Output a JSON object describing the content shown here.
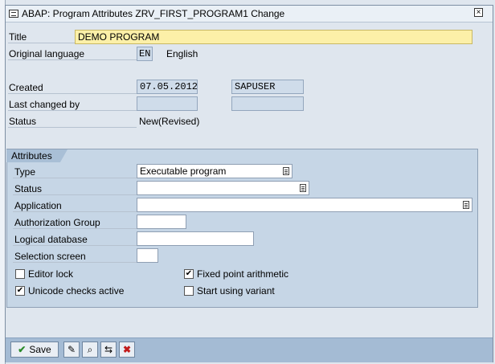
{
  "window": {
    "title": "ABAP: Program Attributes ZRV_FIRST_PROGRAM1 Change"
  },
  "header": {
    "title_label": "Title",
    "title_value": "DEMO PROGRAM",
    "orig_lang_label": "Original language",
    "orig_lang_code": "EN",
    "orig_lang_name": "English",
    "created_label": "Created",
    "created_date": "07.05.2012",
    "created_user": "SAPUSER",
    "last_changed_label": "Last changed by",
    "last_changed_date": "",
    "last_changed_user": "",
    "status_label": "Status",
    "status_value": "New(Revised)"
  },
  "attributes": {
    "tab_label": "Attributes",
    "type_label": "Type",
    "type_value": "Executable program",
    "status_label": "Status",
    "status_value": "",
    "application_label": "Application",
    "application_value": "",
    "auth_group_label": "Authorization Group",
    "auth_group_value": "",
    "logical_db_label": "Logical database",
    "logical_db_value": "",
    "selection_screen_label": "Selection screen",
    "selection_screen_value": "",
    "editor_lock_label": "Editor lock",
    "editor_lock_checked": false,
    "fixed_point_label": "Fixed point arithmetic",
    "fixed_point_checked": true,
    "unicode_label": "Unicode checks active",
    "unicode_checked": true,
    "start_variant_label": "Start using variant",
    "start_variant_checked": false
  },
  "footer": {
    "save_label": "Save",
    "icons": [
      "check-icon",
      "edit-pencil-icon",
      "inspect-icon",
      "hierarchy-icon",
      "cancel-icon"
    ]
  }
}
